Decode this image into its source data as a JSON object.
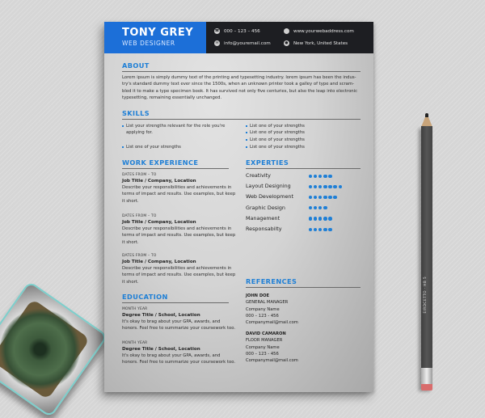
{
  "header": {
    "name": "TONY GREY",
    "role": "WEB DESIGNER",
    "contacts": [
      {
        "icon": "phone-icon",
        "text": "000 – 123 – 456"
      },
      {
        "icon": "envelope-icon",
        "text": "info@youremail.com"
      },
      {
        "icon": "globe-icon",
        "text": "www.yourwebaddress.com"
      },
      {
        "icon": "location-pin-icon",
        "text": "New York, United States"
      }
    ]
  },
  "about": {
    "title": "ABOUT",
    "lines": [
      "Lorem ipsum is simply dummy text of the printing and typesetting industry. lorem ipsum has been the indus-",
      "try's standard dummy text ever since the 1500s, when an unknown printer took a galley of type and scram-",
      "bled it to make a type specimen book. It has survived not only five centuries, but also the leap into electronic",
      "typesetting, remaining essentially unchanged."
    ]
  },
  "skills": {
    "title": "SKILLS",
    "left": [
      "List your strengths relevant for the role you're",
      "applying for.",
      "List one of your strengths"
    ],
    "right": [
      "List one of your strengths",
      "List one of your strengths",
      "List one of your strengths",
      "List one of your strengths"
    ]
  },
  "work": {
    "title": "WORK EXPERIENCE",
    "items": [
      {
        "dates": "DATES FROM – TO",
        "title": "Job Title / Company, Location",
        "lines": [
          "Describe your responsibilities and achievements in",
          "terms of impact and results. Use examples, but keep",
          "it short."
        ]
      },
      {
        "dates": "DATES FROM – TO",
        "title": "Job Title / Company, Location",
        "lines": [
          "Describe your responsibilities and achievements in",
          "terms of impact and results. Use examples, but keep",
          "it short."
        ]
      },
      {
        "dates": "DATES FROM – TO",
        "title": "Job Title / Company, Location",
        "lines": [
          "Describe your responsibilities and achievements in",
          "terms of impact and results. Use examples, but keep",
          "it short."
        ]
      }
    ]
  },
  "expertise": {
    "title": "EXPERTIES",
    "items": [
      {
        "label": "Creativity",
        "rating": 5
      },
      {
        "label": "Layout Designing",
        "rating": 7
      },
      {
        "label": "Web Development",
        "rating": 6
      },
      {
        "label": "Graphic Design",
        "rating": 4
      },
      {
        "label": "Management",
        "rating": 5
      },
      {
        "label": "Responsabilty",
        "rating": 5
      }
    ]
  },
  "education": {
    "title": "EDUCATION",
    "items": [
      {
        "date": "MONTH YEAR",
        "title": "Degree Title / School, Location",
        "lines": [
          "It's okay to brag about your GPA, awards, and",
          "honors. Feel free to summarize your coursework too."
        ]
      },
      {
        "date": "MONTH YEAR",
        "title": "Degree Title / School, Location",
        "lines": [
          "It's okay to brag about your GPA, awards, and",
          "honors. Feel free to summarize your coursework too."
        ]
      }
    ]
  },
  "references": {
    "title": "REFERENCES",
    "items": [
      {
        "name": "JOHN DOE",
        "role": "GENERAL MANAGER",
        "company": "Company Name",
        "phone": "000 – 123 - 456",
        "email": "Companymail@mail.com"
      },
      {
        "name": "DAVID CAMARON",
        "role": "FLOOR MANAGER",
        "company": "Company Name",
        "phone": "000 – 123 - 456",
        "email": "Companymail@mail.com"
      }
    ]
  },
  "pencil": {
    "label": "EIRDCETTO · HB 5"
  },
  "colors": {
    "accent": "#1e7fd6",
    "header_blue": "#1c6fd8",
    "header_dark": "#1d1e22"
  }
}
